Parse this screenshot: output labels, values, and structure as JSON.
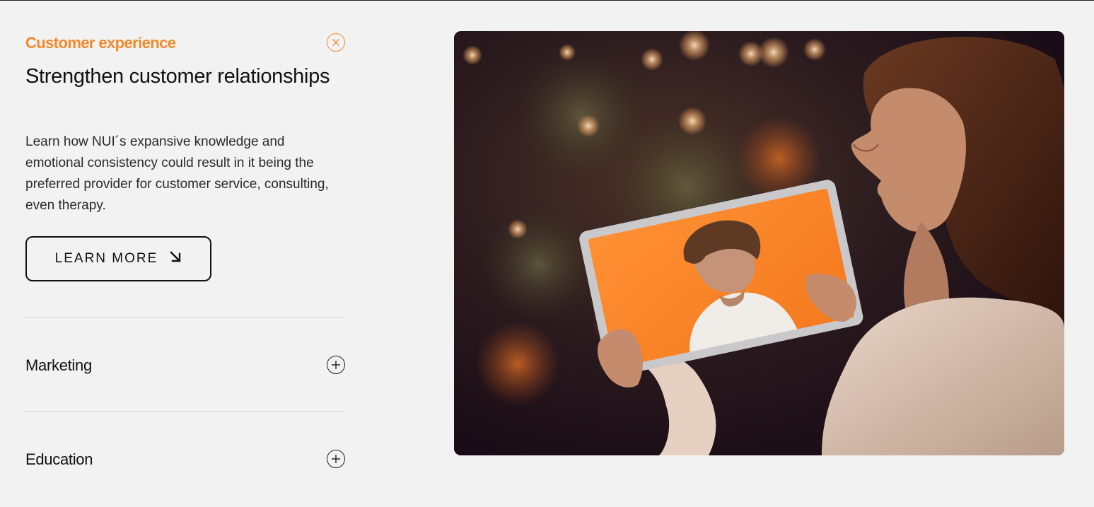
{
  "accordion": {
    "active": {
      "category": "Customer experience",
      "headline": "Strengthen customer relationships",
      "description": "Learn how NUI´s expansive knowledge and emotional consistency could result in it being the preferred provider for customer service, consulting, even therapy.",
      "cta_label": "LEARN MORE",
      "cta_icon": "arrow-down-right-icon",
      "toggle_icon": "close-circle-icon"
    },
    "items": [
      {
        "label": "Marketing",
        "toggle_icon": "plus-circle-icon"
      },
      {
        "label": "Education",
        "toggle_icon": "plus-circle-icon"
      }
    ]
  },
  "hero_image": {
    "subject": "woman holding tablet showing video call with a man on orange background"
  },
  "colors": {
    "accent": "#f08a2c",
    "background": "#f2f2f2",
    "text": "#111111",
    "divider": "#d2d2d2"
  }
}
